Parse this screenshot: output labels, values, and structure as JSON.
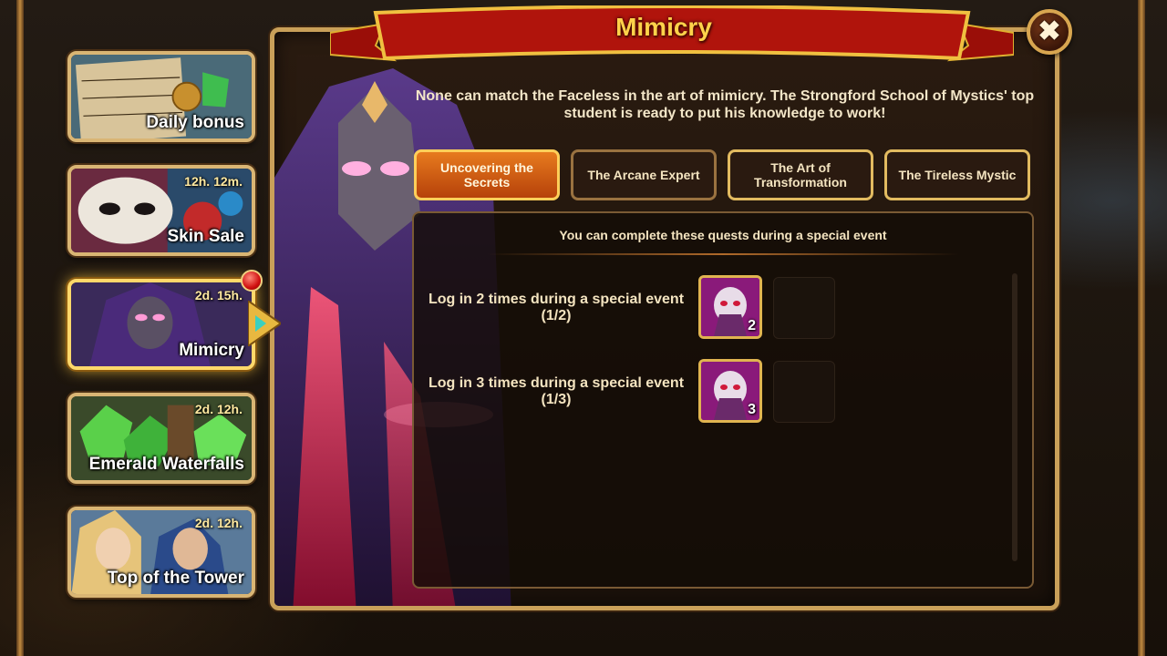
{
  "sidebar": {
    "events": [
      {
        "label": "Daily bonus",
        "timer": ""
      },
      {
        "label": "Skin Sale",
        "timer": "12h. 12m."
      },
      {
        "label": "Mimicry",
        "timer": "2d. 15h."
      },
      {
        "label": "Emerald Waterfalls",
        "timer": "2d. 12h."
      },
      {
        "label": "Top of the Tower",
        "timer": "2d. 12h."
      }
    ]
  },
  "panel": {
    "title": "Mimicry",
    "close_icon": "✖",
    "description": "None can match the Faceless in the art of mimicry. The Strongford School of Mystics' top student is ready to put his knowledge to work!",
    "tabs": [
      {
        "label": "Uncovering the Secrets",
        "active": true
      },
      {
        "label": "The Arcane Expert",
        "active": false
      },
      {
        "label": "The Art of Transformation",
        "active": false
      },
      {
        "label": "The Tireless Mystic",
        "active": false
      }
    ],
    "quest_heading": "You can complete these quests during a special event",
    "quests": [
      {
        "text": "Log in 2 times during a special event",
        "progress": "(1/2)",
        "reward_count": "2"
      },
      {
        "text": "Log in 3 times during a special event",
        "progress": "(1/3)",
        "reward_count": "3"
      }
    ]
  },
  "colors": {
    "gold_border": "#d9b574",
    "active_tab": "#e77b1e",
    "title_gold": "#ffd24a",
    "banner_red": "#b0140c"
  }
}
